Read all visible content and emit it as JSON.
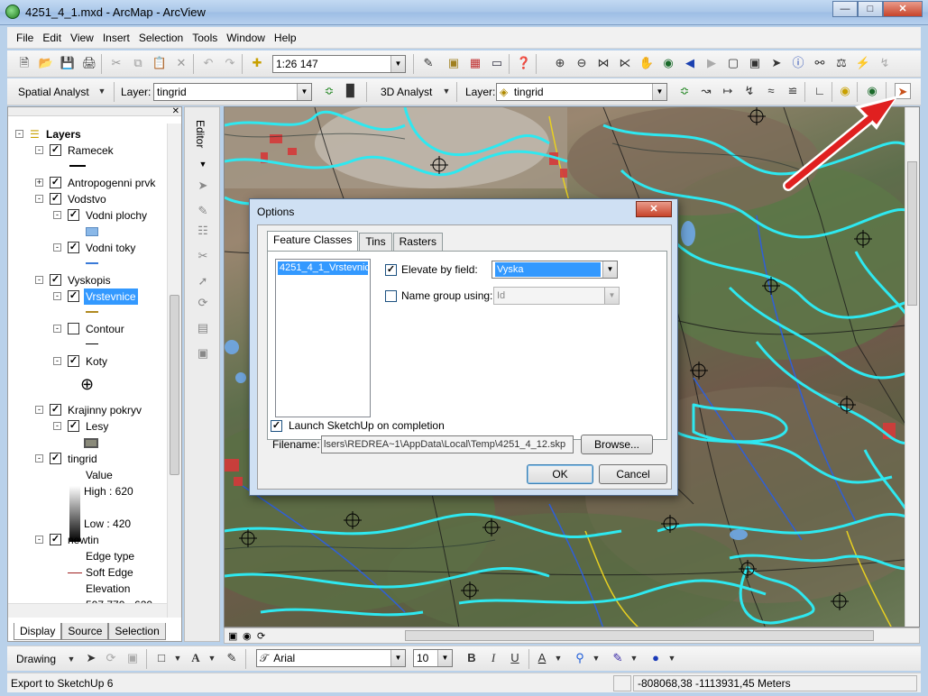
{
  "window": {
    "title": "4251_4_1.mxd - ArcMap - ArcView",
    "minimize": "0",
    "maximize": "1",
    "close": "r"
  },
  "menu": [
    "File",
    "Edit",
    "View",
    "Insert",
    "Selection",
    "Tools",
    "Window",
    "Help"
  ],
  "toolbar1": {
    "scale": "1:26 147"
  },
  "toolbar2": {
    "spatial_analyst": "Spatial Analyst",
    "layer_label": "Layer:",
    "layer_value": "tingrid",
    "analyst3d": "3D Analyst",
    "layer_label2": "Layer:",
    "layer_value2": "tingrid"
  },
  "toc": {
    "root": "Layers",
    "items": [
      {
        "label": "Ramecek"
      },
      {
        "label": "Antropogenni prvk"
      },
      {
        "label": "Vodstvo"
      },
      {
        "label": "Vodni plochy"
      },
      {
        "label": "Vodni toky"
      },
      {
        "label": "Vyskopis"
      },
      {
        "label": "Vrstevnice"
      },
      {
        "label": "Contour"
      },
      {
        "label": "Koty"
      },
      {
        "label": "Krajinny pokryv"
      },
      {
        "label": "Lesy"
      },
      {
        "label": "tingrid"
      },
      {
        "label": "Value"
      },
      {
        "label": "High : 620"
      },
      {
        "label": "Low : 420"
      },
      {
        "label": "newtin"
      },
      {
        "label": "Edge type"
      },
      {
        "label": "Soft Edge"
      },
      {
        "label": "Elevation"
      },
      {
        "label": "507.770 - 620"
      }
    ],
    "tabs": [
      "Display",
      "Source",
      "Selection"
    ]
  },
  "editor": {
    "label": "Editor"
  },
  "dialog": {
    "title": "Options",
    "close": "x",
    "tabs": [
      "Feature Classes",
      "Tins",
      "Rasters"
    ],
    "list_item": "4251_4_1_Vrstevnice",
    "elevate_label": "Elevate by field:",
    "elevate_value": "Vyska",
    "name_group_label": "Name group using:",
    "name_group_value": "Id",
    "launch_label": "Launch SketchUp on completion",
    "filename_label": "Filename:",
    "filename_value": "lsers\\REDREA~1\\AppData\\Local\\Temp\\4251_4_12.skp",
    "browse": "Browse...",
    "ok": "OK",
    "cancel": "Cancel"
  },
  "drawing": {
    "label": "Drawing",
    "font": "Arial",
    "size": "10",
    "bold": "B",
    "italic": "I",
    "underline": "U",
    "text_tool": "A"
  },
  "status": {
    "left": "Export to SketchUp 6",
    "coords": "-808068,38  -1113931,45 Meters"
  },
  "colors": {
    "contour": "#2ee8f0",
    "accent_red": "#e02020",
    "selection": "#3399ff"
  }
}
